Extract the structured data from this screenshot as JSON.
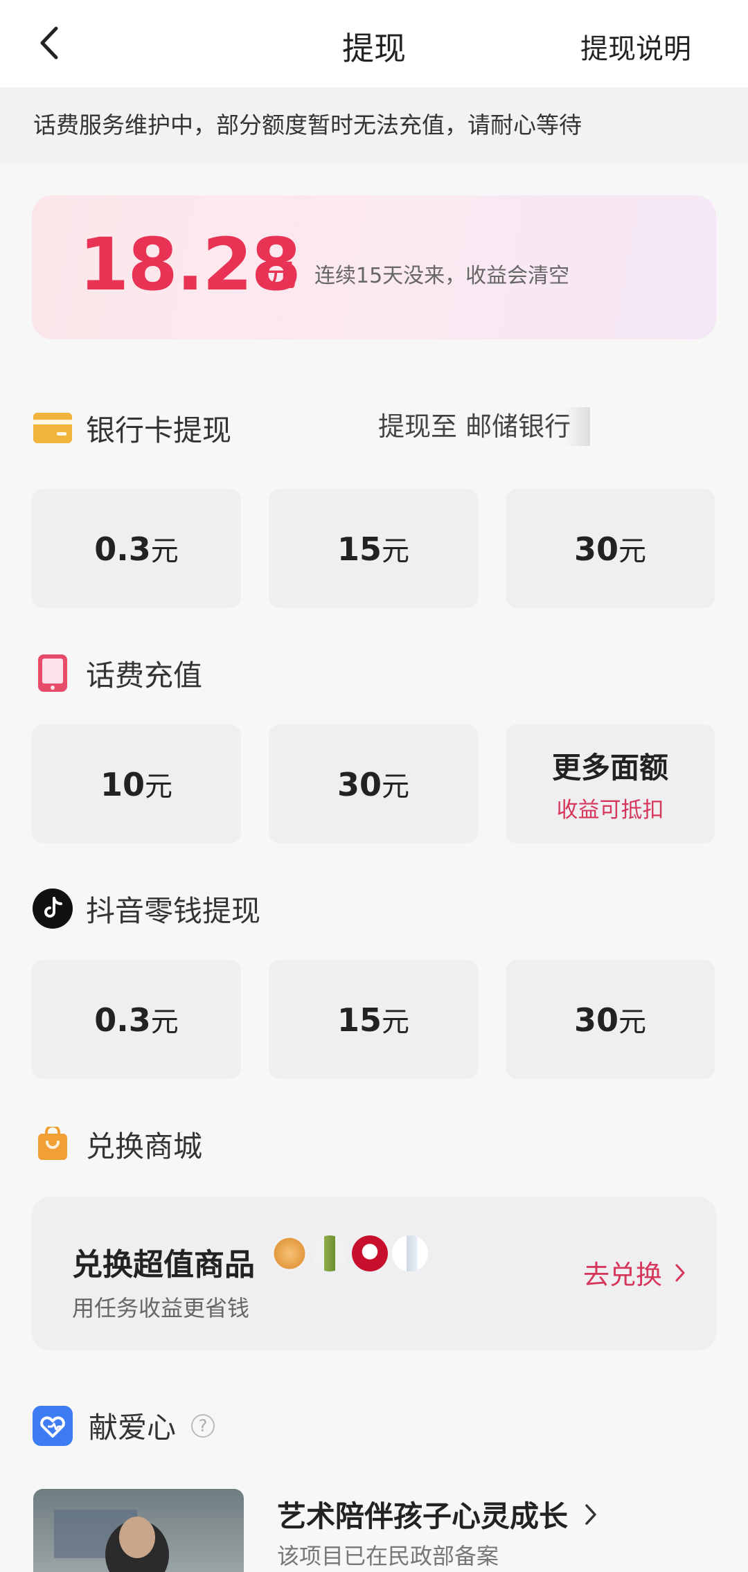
{
  "header": {
    "title": "提现",
    "right_link": "提现说明"
  },
  "notice": "话费服务维护中，部分额度暂时无法充值，请耐心等待",
  "balance": {
    "amount": "18.28",
    "unit": "元",
    "note": "连续15天没来，收益会清空"
  },
  "sections": {
    "bank": {
      "title": "银行卡提现",
      "target": "提现至 邮储银行",
      "options": [
        "0.3",
        "15",
        "30"
      ]
    },
    "phone": {
      "title": "话费充值",
      "options": [
        "10",
        "30"
      ],
      "more_label": "更多面额",
      "more_sub": "收益可抵扣"
    },
    "douyin": {
      "title": "抖音零钱提现",
      "options": [
        "0.3",
        "15",
        "30"
      ]
    },
    "mall": {
      "title": "兑换商城",
      "card_title": "兑换超值商品",
      "card_sub": "用任务收益更省钱",
      "cta": "去兑换"
    },
    "charity": {
      "title": "献爱心",
      "item_title": "艺术陪伴孩子心灵成长",
      "item_sub": "该项目已在民政部备案"
    }
  },
  "currency_unit": "元",
  "colors": {
    "accent": "#e83355",
    "accent_text": "#d6365a",
    "bank_icon": "#f2b33d",
    "phone_icon": "#e64b6a",
    "mall_icon": "#f0a034",
    "charity_icon": "#3d7cf2"
  },
  "icons": {
    "back": "chevron-left-icon",
    "bank": "bank-card-icon",
    "phone": "phone-icon",
    "douyin": "douyin-logo-icon",
    "mall": "shopping-bag-icon",
    "charity": "heart-hand-icon",
    "help": "question-circle-icon"
  }
}
